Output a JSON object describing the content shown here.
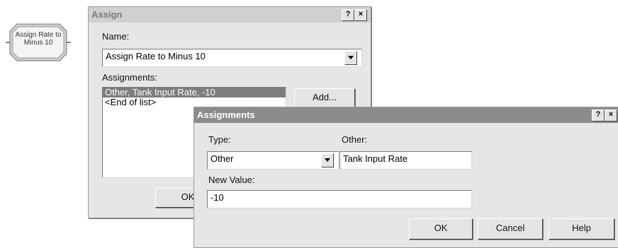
{
  "module": {
    "label_line1": "Assign Rate to",
    "label_line2": "Minus 10"
  },
  "assign_dialog": {
    "title": "Assign",
    "help_btn": "?",
    "close_btn": "×",
    "name_label": "Name:",
    "name_value": "Assign Rate to Minus 10",
    "assignments_label": "Assignments:",
    "list_items": [
      "Other, Tank Input Rate, -10",
      "<End of list>"
    ],
    "add_button": "Add...",
    "ok_button": "OK"
  },
  "assignments_dialog": {
    "title": "Assignments",
    "help_btn": "?",
    "close_btn": "×",
    "type_label": "Type:",
    "type_value": "Other",
    "other_label": "Other:",
    "other_value": "Tank Input Rate",
    "new_value_label": "New Value:",
    "new_value": "-10",
    "ok_button": "OK",
    "cancel_button": "Cancel",
    "help_button": "Help"
  },
  "colors": {
    "active_titlebar": "#8c8c8c",
    "inactive_titlebar": "#d0d0d0",
    "dialog_face": "#e6e6e6",
    "list_selection": "#7d7d7d"
  }
}
